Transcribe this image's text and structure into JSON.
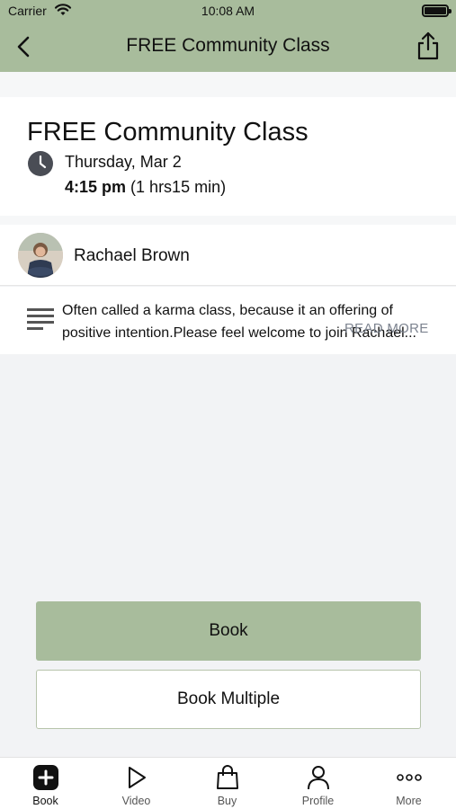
{
  "status_bar": {
    "carrier": "Carrier",
    "time": "10:08 AM"
  },
  "header": {
    "title": "FREE Community Class",
    "back_icon": "chevron-left-icon",
    "share_icon": "share-icon"
  },
  "class_info": {
    "title": "FREE Community Class",
    "date": "Thursday, Mar 2",
    "time_start": "4:15 pm",
    "duration": "(1 hrs15 min)"
  },
  "instructor": {
    "name": "Rachael Brown"
  },
  "description": {
    "text": "Often called a karma class, because it an offering of positive intention.Please feel welcome to join Rachael...",
    "read_more": "READ MORE"
  },
  "actions": {
    "book_label": "Book",
    "book_multiple_label": "Book Multiple"
  },
  "tabbar": {
    "items": [
      {
        "label": "Book",
        "icon": "plus-square-icon"
      },
      {
        "label": "Video",
        "icon": "play-icon"
      },
      {
        "label": "Buy",
        "icon": "shopping-bag-icon"
      },
      {
        "label": "Profile",
        "icon": "person-icon"
      },
      {
        "label": "More",
        "icon": "ellipsis-icon"
      }
    ]
  },
  "colors": {
    "accent": "#a8bc9c",
    "background": "#f2f3f5"
  }
}
